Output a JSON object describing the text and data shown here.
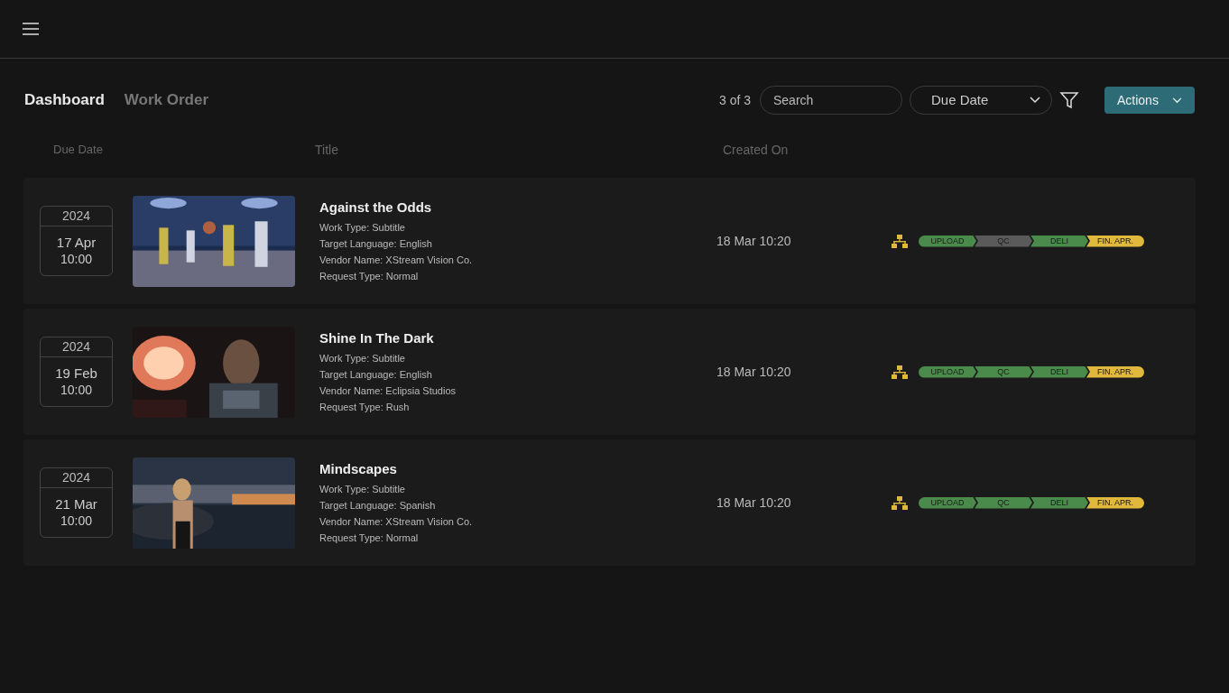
{
  "tabs": [
    {
      "label": "Dashboard",
      "selected": true
    },
    {
      "label": "Work Order",
      "selected": false
    }
  ],
  "toolbar": {
    "count": "3 of 3",
    "search": {
      "placeholder": "Search"
    },
    "sort": {
      "value": "Due Date"
    },
    "actions": "Actions"
  },
  "table": {
    "columns": [
      "Due Date",
      "Title",
      "Created On"
    ],
    "rows": [
      {
        "year": "2024",
        "date": "17 Apr",
        "time": "10:00",
        "title": "Against the Odds",
        "details": [
          "Work Type: Subtitle",
          "Target Language: English",
          "Vendor Name: XStream Vision Co.",
          "Request Type: Normal"
        ],
        "created": "18 Mar 10:20",
        "stages": [
          {
            "label": "UPLOAD",
            "color": "#4a8a4a"
          },
          {
            "label": "QC",
            "color": "#5a5a5a"
          },
          {
            "label": "DELI",
            "color": "#4a8a4a"
          },
          {
            "label": "FIN. APR.",
            "color": "#e0b83c"
          }
        ]
      },
      {
        "year": "2024",
        "date": "19 Feb",
        "time": "10:00",
        "title": "Shine In The Dark",
        "details": [
          "Work Type: Subtitle",
          "Target Language: English",
          "Vendor Name: Eclipsia Studios",
          "Request Type: Rush"
        ],
        "created": "18 Mar 10:20",
        "stages": [
          {
            "label": "UPLOAD",
            "color": "#4a8a4a"
          },
          {
            "label": "QC",
            "color": "#4a8a4a"
          },
          {
            "label": "DELI",
            "color": "#4a8a4a"
          },
          {
            "label": "FIN. APR.",
            "color": "#e0b83c"
          }
        ]
      },
      {
        "year": "2024",
        "date": "21 Mar",
        "time": "10:00",
        "title": "Mindscapes",
        "details": [
          "Work Type: Subtitle",
          "Target Language: Spanish",
          "Vendor Name: XStream Vision Co.",
          "Request Type: Normal"
        ],
        "created": "18 Mar 10:20",
        "stages": [
          {
            "label": "UPLOAD",
            "color": "#4a8a4a"
          },
          {
            "label": "QC",
            "color": "#4a8a4a"
          },
          {
            "label": "DELI",
            "color": "#4a8a4a"
          },
          {
            "label": "FIN. APR.",
            "color": "#e0b83c"
          }
        ]
      }
    ]
  }
}
